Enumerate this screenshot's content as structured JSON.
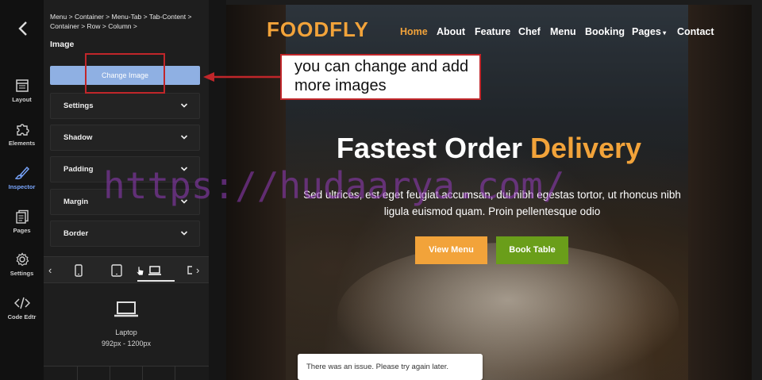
{
  "rail": {
    "items": [
      {
        "label": "Layout",
        "icon": "layout-icon"
      },
      {
        "label": "Elements",
        "icon": "puzzle-icon"
      },
      {
        "label": "Inspector",
        "icon": "brush-icon"
      },
      {
        "label": "Pages",
        "icon": "pages-icon"
      },
      {
        "label": "Settings",
        "icon": "gear-icon"
      },
      {
        "label": "Code Edtr",
        "icon": "code-icon"
      }
    ],
    "active": "Inspector"
  },
  "inspector": {
    "breadcrumb": "Menu > Container > Menu-Tab > Tab-Content > Container > Row > Column >",
    "section_title": "Image",
    "change_button": "Change Image",
    "accordions": [
      "Settings",
      "Shadow",
      "Padding",
      "Margin",
      "Border"
    ]
  },
  "device": {
    "name": "Laptop",
    "range": "992px - 1200px"
  },
  "site": {
    "logo": "FOODFLY",
    "nav": [
      "Home",
      "About",
      "Feature",
      "Chef",
      "Menu",
      "Booking",
      "Pages",
      "Contact"
    ],
    "active_nav": "Home",
    "hero_title_main": "Fastest Order ",
    "hero_title_accent": "Delivery",
    "hero_subtitle": "Sed ultrices, est eget feugiat accumsan, dui nibh egestas tortor, ut rhoncus nibh ligula euismod quam. Proin pellentesque odio",
    "btn_menu": "View Menu",
    "btn_book": "Book Table",
    "toast": "There was an issue. Please try again later."
  },
  "annotation": {
    "note": "you can change and add more images"
  },
  "watermark": "https://hudaarya.com/",
  "colors": {
    "accent": "#f2a33a",
    "green": "#6a9e1a",
    "change_button": "#8fb0e3",
    "inspector_active": "#7aa7ff",
    "annotation_red": "#c0262a"
  }
}
